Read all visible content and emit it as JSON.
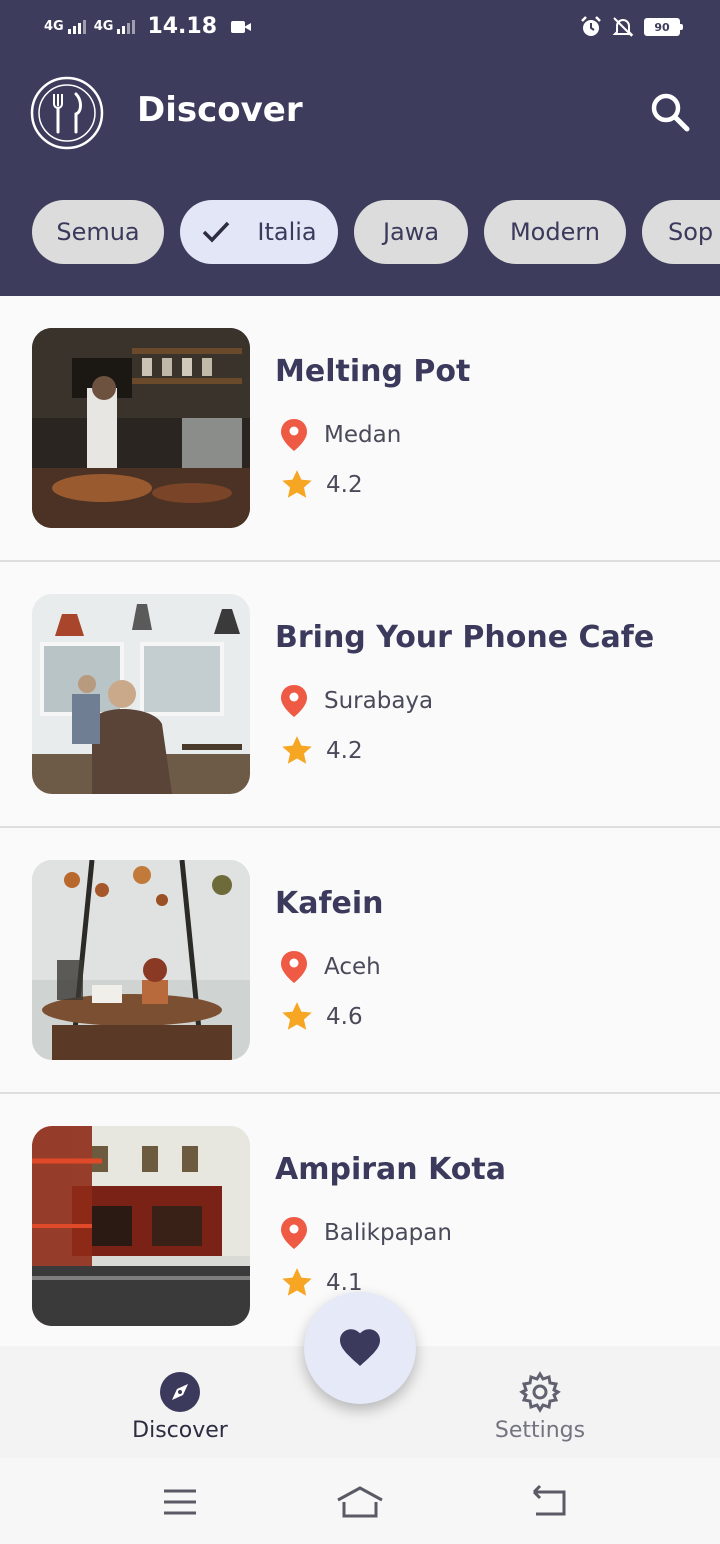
{
  "status_bar": {
    "network_1": "4G",
    "network_2": "4G",
    "time": "14.18",
    "battery": "90"
  },
  "header": {
    "title": "Discover",
    "logo_icon": "fork-knife-logo-icon",
    "search_icon": "search-icon"
  },
  "chips": [
    {
      "label": "Semua",
      "selected": false
    },
    {
      "label": "Italia",
      "selected": true
    },
    {
      "label": "Jawa",
      "selected": false
    },
    {
      "label": "Modern",
      "selected": false
    },
    {
      "label": "Sop",
      "selected": false
    }
  ],
  "restaurants": [
    {
      "name": "Melting Pot",
      "city": "Medan",
      "rating": "4.2"
    },
    {
      "name": "Bring Your Phone Cafe",
      "city": "Surabaya",
      "rating": "4.2"
    },
    {
      "name": "Kafein",
      "city": "Aceh",
      "rating": "4.6"
    },
    {
      "name": "Ampiran Kota",
      "city": "Balikpapan",
      "rating": "4.1"
    }
  ],
  "bottom_nav": {
    "discover_label": "Discover",
    "settings_label": "Settings",
    "favorite_icon": "heart-icon"
  },
  "colors": {
    "header_bg": "#3e3c5d",
    "accent": "#3b3a5c",
    "chip_bg": "#dcdcdc",
    "chip_selected_bg": "#e3e6f7",
    "pin": "#ef5a45",
    "star": "#f6a623"
  }
}
